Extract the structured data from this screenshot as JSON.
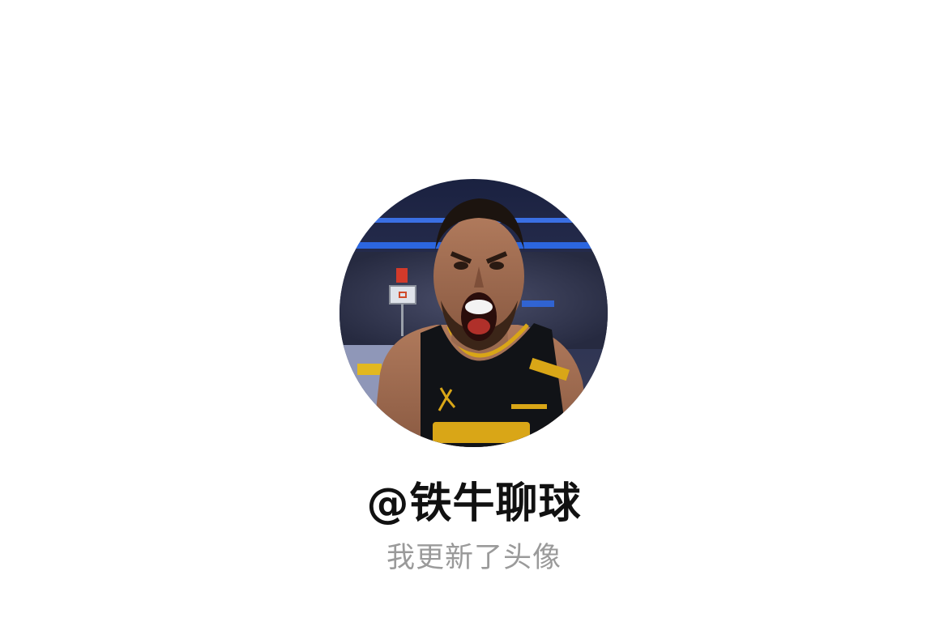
{
  "profile": {
    "avatar_alt": "avatar",
    "username": "@铁牛聊球",
    "status_text": "我更新了头像"
  },
  "colors": {
    "background": "#ffffff",
    "username": "#111111",
    "status": "#9a9a9a"
  }
}
